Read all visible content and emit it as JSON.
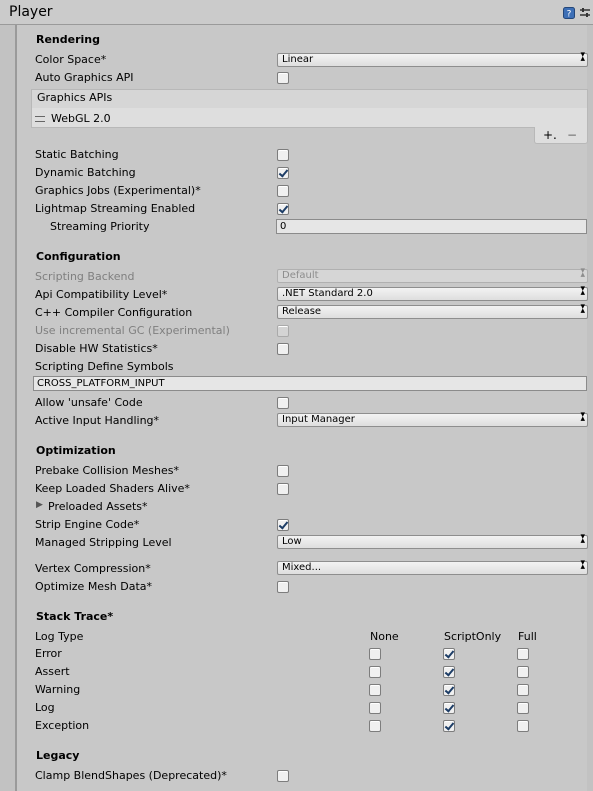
{
  "window": {
    "title": "Player"
  },
  "rendering": {
    "heading": "Rendering",
    "color_space": {
      "label": "Color Space*",
      "value": "Linear"
    },
    "auto_graphics_api": {
      "label": "Auto Graphics API",
      "checked": false
    },
    "graphics_apis": {
      "label": "Graphics APIs",
      "items": [
        "WebGL 2.0"
      ],
      "add": "+.",
      "remove": "−"
    },
    "static_batching": {
      "label": "Static Batching",
      "checked": false
    },
    "dynamic_batching": {
      "label": "Dynamic Batching",
      "checked": true
    },
    "graphics_jobs": {
      "label": "Graphics Jobs (Experimental)*",
      "checked": false
    },
    "lightmap_streaming": {
      "label": "Lightmap Streaming Enabled",
      "checked": true
    },
    "streaming_priority": {
      "label": "Streaming Priority",
      "value": "0"
    }
  },
  "configuration": {
    "heading": "Configuration",
    "scripting_backend": {
      "label": "Scripting Backend",
      "value": "Default"
    },
    "api_compat": {
      "label": "Api Compatibility Level*",
      "value": ".NET Standard 2.0"
    },
    "cpp_compiler": {
      "label": "C++ Compiler Configuration",
      "value": "Release"
    },
    "incremental_gc": {
      "label": "Use incremental GC (Experimental)",
      "checked": false
    },
    "disable_hw_stats": {
      "label": "Disable HW Statistics*",
      "checked": false
    },
    "define_symbols": {
      "label": "Scripting Define Symbols",
      "value": "CROSS_PLATFORM_INPUT"
    },
    "allow_unsafe": {
      "label": "Allow 'unsafe' Code",
      "checked": false
    },
    "active_input": {
      "label": "Active Input Handling*",
      "value": "Input Manager"
    }
  },
  "optimization": {
    "heading": "Optimization",
    "prebake": {
      "label": "Prebake Collision Meshes*",
      "checked": false
    },
    "keep_shaders": {
      "label": "Keep Loaded Shaders Alive*",
      "checked": false
    },
    "preloaded_assets": {
      "label": "Preloaded Assets*"
    },
    "strip_engine": {
      "label": "Strip Engine Code*",
      "checked": true
    },
    "managed_stripping": {
      "label": "Managed Stripping Level",
      "value": "Low"
    },
    "vertex_compression": {
      "label": "Vertex Compression*",
      "value": "Mixed..."
    },
    "optimize_mesh": {
      "label": "Optimize Mesh Data*",
      "checked": false
    }
  },
  "stack_trace": {
    "heading": "Stack Trace*",
    "col_log_type": "Log Type",
    "col_none": "None",
    "col_script": "ScriptOnly",
    "col_full": "Full",
    "rows": [
      {
        "label": "Error",
        "selected": "ScriptOnly"
      },
      {
        "label": "Assert",
        "selected": "ScriptOnly"
      },
      {
        "label": "Warning",
        "selected": "ScriptOnly"
      },
      {
        "label": "Log",
        "selected": "ScriptOnly"
      },
      {
        "label": "Exception",
        "selected": "ScriptOnly"
      }
    ]
  },
  "legacy": {
    "heading": "Legacy",
    "clamp_blendshapes": {
      "label": "Clamp BlendShapes (Deprecated)*",
      "checked": false
    }
  },
  "icons": [
    "help-icon",
    "settings-icon",
    "drag-handle-icon",
    "foldout-arrow-icon",
    "dropdown-arrow-icon",
    "checkmark-icon"
  ]
}
